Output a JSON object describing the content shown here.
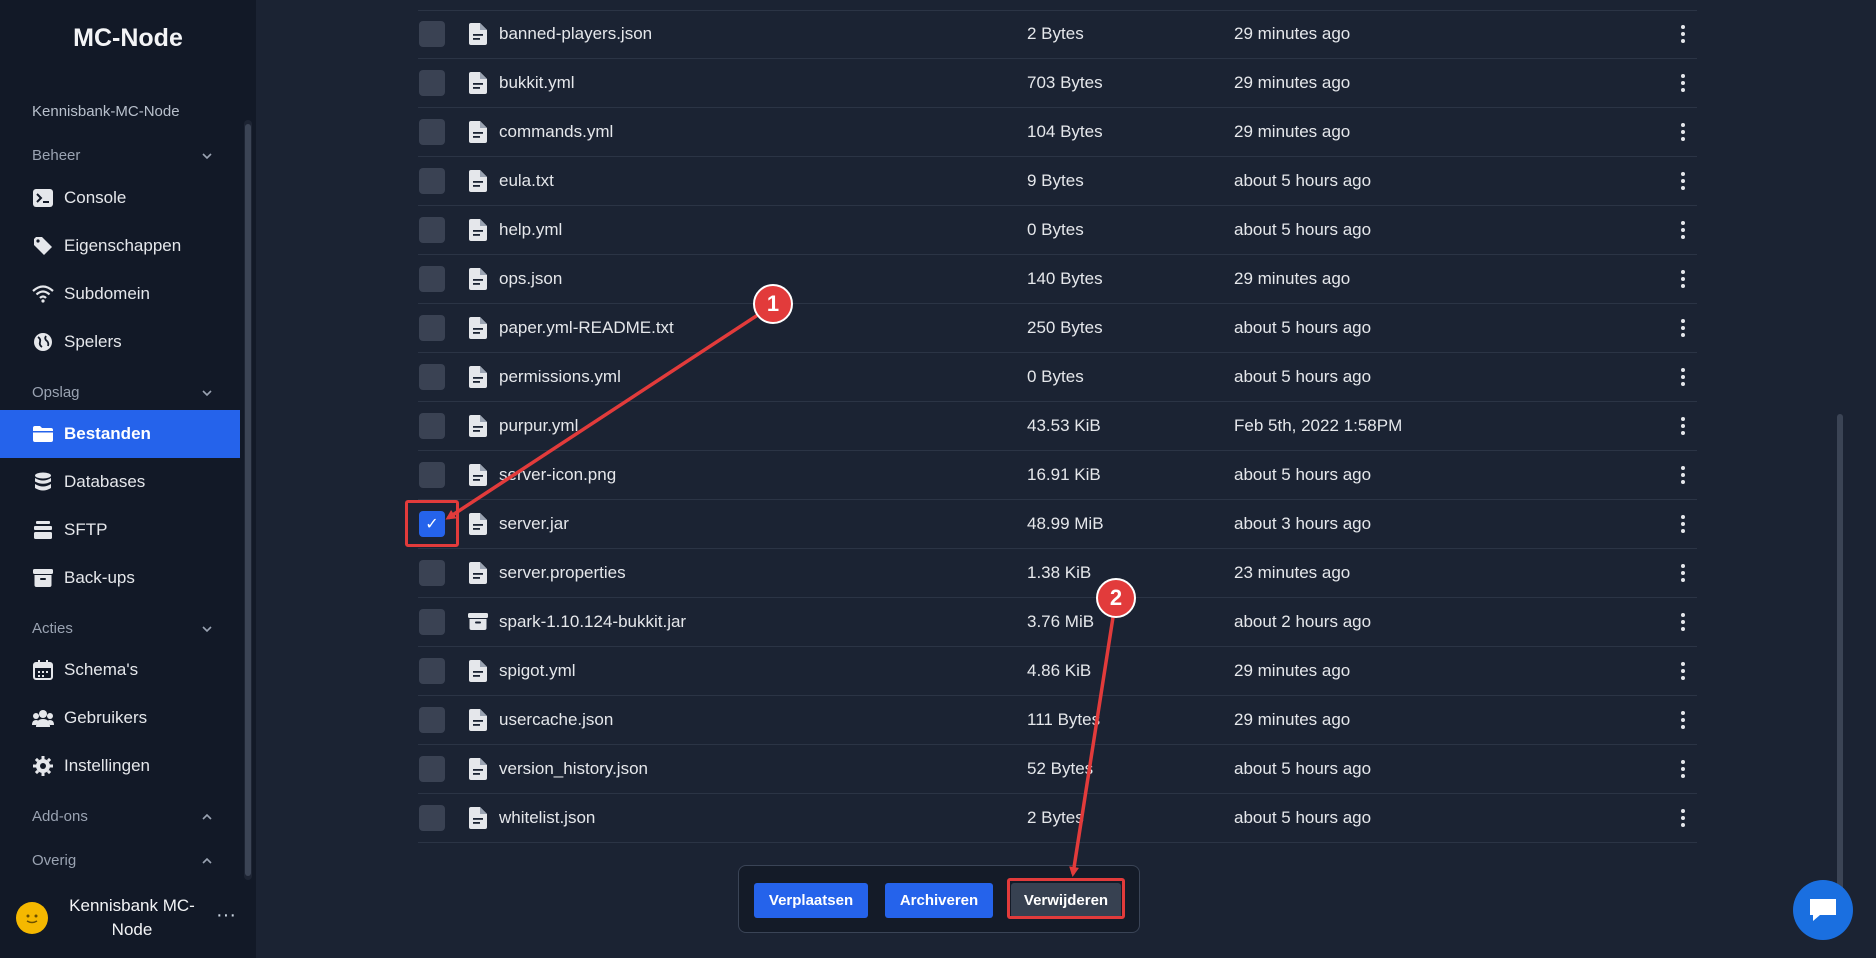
{
  "app": {
    "brand": "MC-Node",
    "workspace": "Kennisbank-MC-Node"
  },
  "sidebar": {
    "sections": [
      {
        "label": "Beheer",
        "state": "expanded"
      },
      {
        "label": "Opslag",
        "state": "expanded"
      },
      {
        "label": "Acties",
        "state": "expanded"
      },
      {
        "label": "Add-ons",
        "state": "collapsed"
      },
      {
        "label": "Overig",
        "state": "collapsed"
      }
    ],
    "items": [
      {
        "label": "Console",
        "icon": "terminal-icon"
      },
      {
        "label": "Eigenschappen",
        "icon": "tag-icon"
      },
      {
        "label": "Subdomein",
        "icon": "wifi-icon"
      },
      {
        "label": "Spelers",
        "icon": "globe-icon"
      },
      {
        "label": "Bestanden",
        "icon": "folder-icon",
        "active": true
      },
      {
        "label": "Databases",
        "icon": "database-icon"
      },
      {
        "label": "SFTP",
        "icon": "server-icon"
      },
      {
        "label": "Back-ups",
        "icon": "archive-icon"
      },
      {
        "label": "Schema's",
        "icon": "calendar-icon"
      },
      {
        "label": "Gebruikers",
        "icon": "users-icon"
      },
      {
        "label": "Instellingen",
        "icon": "gear-icon"
      }
    ],
    "user": {
      "name": "Kennisbank MC-Node",
      "more": "···"
    }
  },
  "files": [
    {
      "name": "banned-players.json",
      "size": "2 Bytes",
      "modified": "29 minutes ago",
      "type": "file",
      "checked": false
    },
    {
      "name": "bukkit.yml",
      "size": "703 Bytes",
      "modified": "29 minutes ago",
      "type": "file",
      "checked": false
    },
    {
      "name": "commands.yml",
      "size": "104 Bytes",
      "modified": "29 minutes ago",
      "type": "file",
      "checked": false
    },
    {
      "name": "eula.txt",
      "size": "9 Bytes",
      "modified": "about 5 hours ago",
      "type": "file",
      "checked": false
    },
    {
      "name": "help.yml",
      "size": "0 Bytes",
      "modified": "about 5 hours ago",
      "type": "file",
      "checked": false
    },
    {
      "name": "ops.json",
      "size": "140 Bytes",
      "modified": "29 minutes ago",
      "type": "file",
      "checked": false
    },
    {
      "name": "paper.yml-README.txt",
      "size": "250 Bytes",
      "modified": "about 5 hours ago",
      "type": "file",
      "checked": false
    },
    {
      "name": "permissions.yml",
      "size": "0 Bytes",
      "modified": "about 5 hours ago",
      "type": "file",
      "checked": false
    },
    {
      "name": "purpur.yml",
      "size": "43.53 KiB",
      "modified": "Feb 5th, 2022 1:58PM",
      "type": "file",
      "checked": false
    },
    {
      "name": "server-icon.png",
      "size": "16.91 KiB",
      "modified": "about 5 hours ago",
      "type": "file",
      "checked": false
    },
    {
      "name": "server.jar",
      "size": "48.99 MiB",
      "modified": "about 3 hours ago",
      "type": "file",
      "checked": true
    },
    {
      "name": "server.properties",
      "size": "1.38 KiB",
      "modified": "23 minutes ago",
      "type": "file",
      "checked": false
    },
    {
      "name": "spark-1.10.124-bukkit.jar",
      "size": "3.76 MiB",
      "modified": "about 2 hours ago",
      "type": "archive",
      "checked": false
    },
    {
      "name": "spigot.yml",
      "size": "4.86 KiB",
      "modified": "29 minutes ago",
      "type": "file",
      "checked": false
    },
    {
      "name": "usercache.json",
      "size": "111 Bytes",
      "modified": "29 minutes ago",
      "type": "file",
      "checked": false
    },
    {
      "name": "version_history.json",
      "size": "52 Bytes",
      "modified": "about 5 hours ago",
      "type": "file",
      "checked": false
    },
    {
      "name": "whitelist.json",
      "size": "2 Bytes",
      "modified": "about 5 hours ago",
      "type": "file",
      "checked": false
    }
  ],
  "actions": {
    "move": "Verplaatsen",
    "archive": "Archiveren",
    "delete": "Verwijderen"
  },
  "annotations": {
    "badge1": "1",
    "badge2": "2",
    "color": "#e23b3b"
  },
  "colors": {
    "accent": "#2563eb",
    "sidebar_bg": "#121927",
    "main_bg": "#1b2333"
  }
}
